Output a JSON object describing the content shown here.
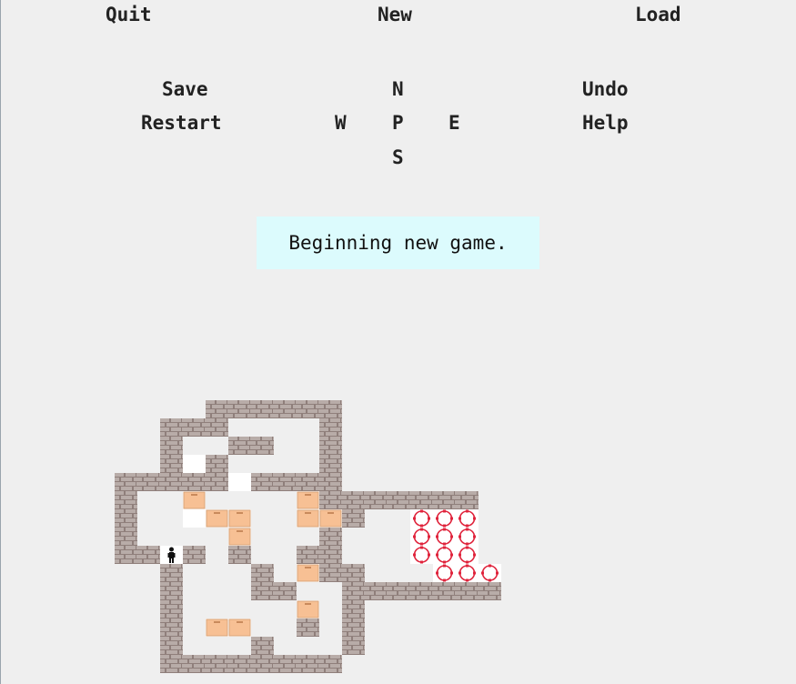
{
  "menu": {
    "quit": "Quit",
    "new": "New",
    "load": "Load",
    "save": "Save",
    "restart": "Restart",
    "undo": "Undo",
    "help": "Help"
  },
  "compass": {
    "n": "N",
    "s": "S",
    "w": "W",
    "e": "E",
    "p": "P"
  },
  "status": "Beginning new game.",
  "colors": {
    "background": "#efefef",
    "status_bg": "#dcfbfd",
    "box": "#f7c094",
    "goal": "#e0243c",
    "brick": "#8f7f7b"
  },
  "level": {
    "rows": [
      "    ######      ",
      "  ###    #      ",
      "  #  ##  #      ",
      "  #.#    #      ",
      "#####.####      ",
      "#  $    $#######",
      "#  .$$  $$#  ggg",
      "#    $   #   ggg",
      "##*# #  ##   ggg",
      "  #   # $##   ggg",
      "  #   ##  #######",
      "  #     $ #     ",
      "  # $$  # #     ",
      "  #   #   #     ",
      "  ########      "
    ]
  }
}
